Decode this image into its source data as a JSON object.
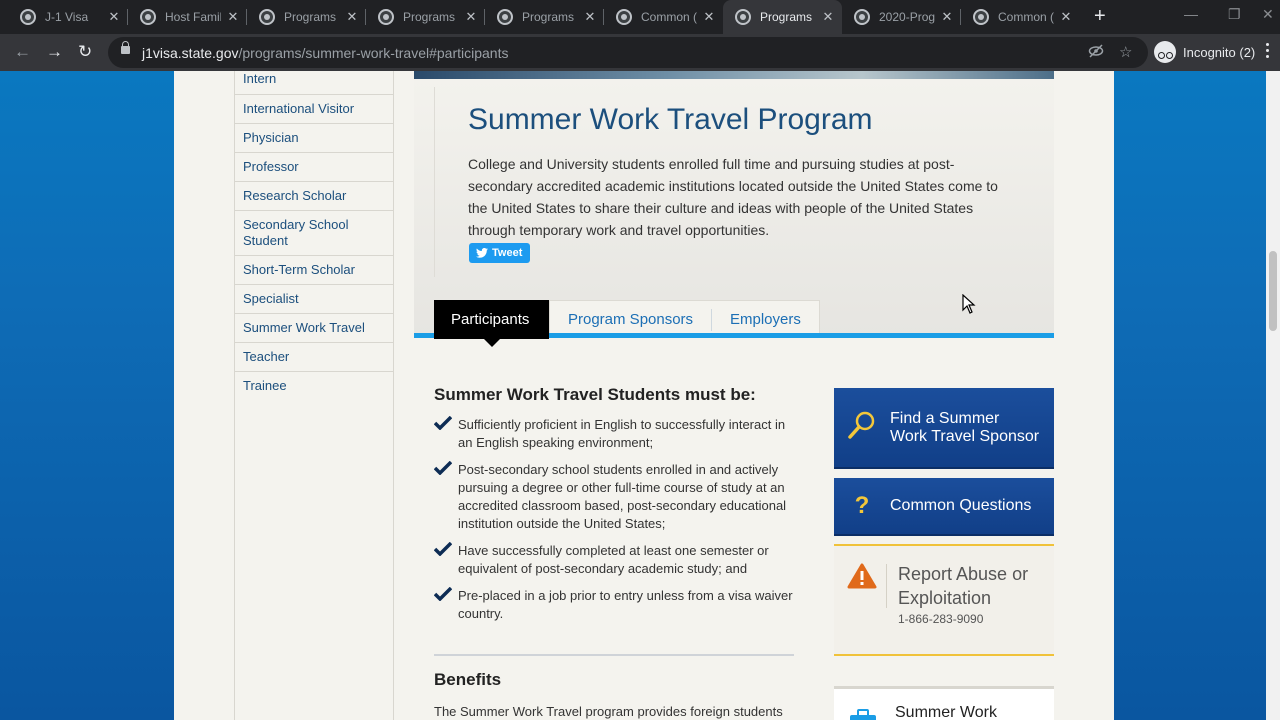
{
  "browser": {
    "tabs": [
      {
        "title": "J-1 Visa",
        "active": false
      },
      {
        "title": "Host Famil",
        "active": false
      },
      {
        "title": "Programs",
        "active": false
      },
      {
        "title": "Programs",
        "active": false
      },
      {
        "title": "Programs",
        "active": false
      },
      {
        "title": "Common (",
        "active": false
      },
      {
        "title": "Programs",
        "active": true
      },
      {
        "title": "2020-Prog",
        "active": false
      },
      {
        "title": "Common (",
        "active": false
      }
    ],
    "url_host": "j1visa.state.gov",
    "url_path": "/programs/summer-work-travel#participants",
    "profile_label": "Incognito (2)"
  },
  "sidebar": {
    "items": [
      "Intern",
      "International Visitor",
      "Physician",
      "Professor",
      "Research Scholar",
      "Secondary School Student",
      "Short-Term Scholar",
      "Specialist",
      "Summer Work Travel",
      "Teacher",
      "Trainee"
    ]
  },
  "hero": {
    "title": "Summer Work Travel Program",
    "description": "College and University students enrolled full time and pursuing studies at post-secondary accredited academic institutions located outside the United States come to the United States to share their culture and ideas with people of the United States through temporary work and travel opportunities.",
    "tweet_label": "Tweet"
  },
  "program_tabs": {
    "items": [
      "Participants",
      "Program Sponsors",
      "Employers"
    ],
    "active": "Participants"
  },
  "requirements": {
    "title": "Summer Work Travel Students must be:",
    "items": [
      "Sufficiently proficient in English to successfully interact in an English speaking environment;",
      "Post-secondary school students enrolled in and actively pursuing a degree or other full-time course of study at an accredited classroom based, post-secondary educational institution outside the United States;",
      "Have successfully completed at least one semester or equivalent of post-secondary academic study; and",
      "Pre-placed in a job prior to entry unless from a visa waiver country."
    ]
  },
  "benefits": {
    "title": "Benefits",
    "text": "The Summer Work Travel program provides foreign students"
  },
  "cards": {
    "find_sponsor": "Find a Summer Work Travel Sponsor",
    "common_questions": "Common Questions",
    "report_title": "Report Abuse or Exploitation",
    "report_phone": "1-866-283-9090",
    "summer_work": "Summer Work"
  },
  "colors": {
    "link_blue": "#1c4f7d",
    "accent_blue": "#1a9de6",
    "card_blue": "#143f8a",
    "warning_orange": "#e06a1b",
    "report_border": "#f0c23a"
  },
  "icons": [
    "back-icon",
    "forward-icon",
    "reload-icon",
    "lock-icon",
    "eye-off-icon",
    "star-icon",
    "incognito-icon",
    "twitter-bird-icon",
    "checkmark-icon",
    "magnifier-icon",
    "question-icon",
    "warning-icon",
    "briefcase-icon"
  ]
}
